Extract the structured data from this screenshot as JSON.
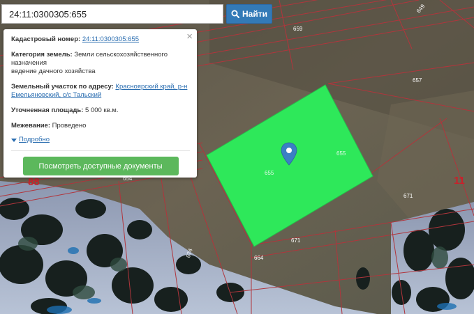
{
  "search": {
    "value": "24:11:0300305:655",
    "button_label": "Найти"
  },
  "popup": {
    "close": "×",
    "cadastral_label": "Кадастровый номер:",
    "cadastral_value": "24:11:0300305:655",
    "category_label": "Категория земель:",
    "category_value": "Земли сельскохозяйственного назначения",
    "use_value": "ведение дачного хозяйства",
    "address_label": "Земельный участок по адресу:",
    "address_value": "Красноярский край, р-н Емельяновский, с/с Тальский",
    "area_label": "Уточненная площадь:",
    "area_value": "5 000 кв.м.",
    "survey_label": "Межевание:",
    "survey_value": "Проведено",
    "details_link": "Подробно",
    "docs_button": "Посмотреть доступные документы"
  },
  "map": {
    "parcel_labels": [
      "659",
      "649",
      "657",
      "655",
      "655",
      "671",
      "671",
      "664",
      "674",
      "654"
    ],
    "block_labels": [
      "88",
      "11"
    ],
    "colors": {
      "parcel_fill": "#2ee85a",
      "boundary": "#b1353c",
      "label": "#ffffff",
      "block": "#c9202a"
    },
    "marker": "map-marker-icon"
  }
}
